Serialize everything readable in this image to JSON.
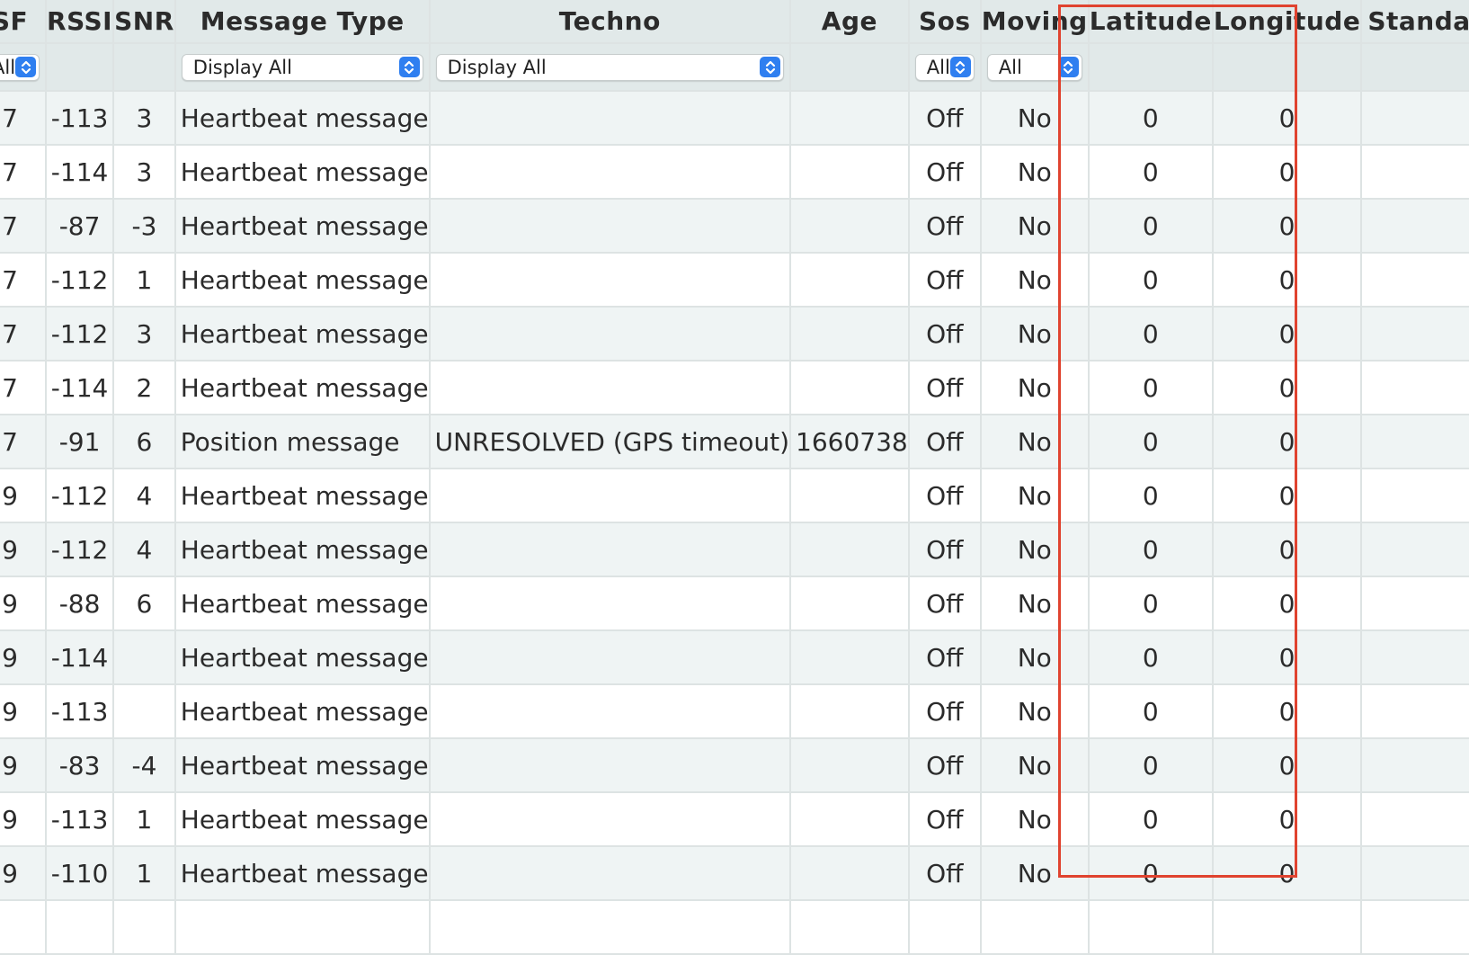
{
  "columns": {
    "sf": "SF",
    "rssi": "RSSI",
    "snr": "SNR",
    "message_type": "Message Type",
    "techno": "Techno",
    "age": "Age",
    "sos": "Sos",
    "moving": "Moving",
    "latitude": "Latitude",
    "longitude": "Longitude",
    "standard": "Standard"
  },
  "filters": {
    "sf": "All",
    "message_type": "Display All",
    "techno": "Display All",
    "sos": "All",
    "moving": "All"
  },
  "rows": [
    {
      "sf": "7",
      "rssi": "-113",
      "snr": "3",
      "message_type": "Heartbeat message",
      "techno": "",
      "age": "",
      "sos": "Off",
      "moving": "No",
      "latitude": "0",
      "longitude": "0"
    },
    {
      "sf": "7",
      "rssi": "-114",
      "snr": "3",
      "message_type": "Heartbeat message",
      "techno": "",
      "age": "",
      "sos": "Off",
      "moving": "No",
      "latitude": "0",
      "longitude": "0"
    },
    {
      "sf": "7",
      "rssi": "-87",
      "snr": "-3",
      "message_type": "Heartbeat message",
      "techno": "",
      "age": "",
      "sos": "Off",
      "moving": "No",
      "latitude": "0",
      "longitude": "0"
    },
    {
      "sf": "7",
      "rssi": "-112",
      "snr": "1",
      "message_type": "Heartbeat message",
      "techno": "",
      "age": "",
      "sos": "Off",
      "moving": "No",
      "latitude": "0",
      "longitude": "0"
    },
    {
      "sf": "7",
      "rssi": "-112",
      "snr": "3",
      "message_type": "Heartbeat message",
      "techno": "",
      "age": "",
      "sos": "Off",
      "moving": "No",
      "latitude": "0",
      "longitude": "0"
    },
    {
      "sf": "7",
      "rssi": "-114",
      "snr": "2",
      "message_type": "Heartbeat message",
      "techno": "",
      "age": "",
      "sos": "Off",
      "moving": "No",
      "latitude": "0",
      "longitude": "0"
    },
    {
      "sf": "7",
      "rssi": "-91",
      "snr": "6",
      "message_type": "Position message",
      "techno": "UNRESOLVED (GPS timeout)",
      "age": "1660738",
      "sos": "Off",
      "moving": "No",
      "latitude": "0",
      "longitude": "0"
    },
    {
      "sf": "9",
      "rssi": "-112",
      "snr": "4",
      "message_type": "Heartbeat message",
      "techno": "",
      "age": "",
      "sos": "Off",
      "moving": "No",
      "latitude": "0",
      "longitude": "0"
    },
    {
      "sf": "9",
      "rssi": "-112",
      "snr": "4",
      "message_type": "Heartbeat message",
      "techno": "",
      "age": "",
      "sos": "Off",
      "moving": "No",
      "latitude": "0",
      "longitude": "0"
    },
    {
      "sf": "9",
      "rssi": "-88",
      "snr": "6",
      "message_type": "Heartbeat message",
      "techno": "",
      "age": "",
      "sos": "Off",
      "moving": "No",
      "latitude": "0",
      "longitude": "0"
    },
    {
      "sf": "9",
      "rssi": "-114",
      "snr": "",
      "message_type": "Heartbeat message",
      "techno": "",
      "age": "",
      "sos": "Off",
      "moving": "No",
      "latitude": "0",
      "longitude": "0"
    },
    {
      "sf": "9",
      "rssi": "-113",
      "snr": "",
      "message_type": "Heartbeat message",
      "techno": "",
      "age": "",
      "sos": "Off",
      "moving": "No",
      "latitude": "0",
      "longitude": "0"
    },
    {
      "sf": "9",
      "rssi": "-83",
      "snr": "-4",
      "message_type": "Heartbeat message",
      "techno": "",
      "age": "",
      "sos": "Off",
      "moving": "No",
      "latitude": "0",
      "longitude": "0"
    },
    {
      "sf": "9",
      "rssi": "-113",
      "snr": "1",
      "message_type": "Heartbeat message",
      "techno": "",
      "age": "",
      "sos": "Off",
      "moving": "No",
      "latitude": "0",
      "longitude": "0"
    },
    {
      "sf": "9",
      "rssi": "-110",
      "snr": "1",
      "message_type": "Heartbeat message",
      "techno": "",
      "age": "",
      "sos": "Off",
      "moving": "No",
      "latitude": "0",
      "longitude": "0"
    },
    {
      "sf": "",
      "rssi": "",
      "snr": "",
      "message_type": "",
      "techno": "",
      "age": "",
      "sos": "",
      "moving": "",
      "latitude": "",
      "longitude": ""
    }
  ],
  "colors": {
    "header_bg": "#e1e9e9",
    "row_alt_bg": "#eff4f4",
    "select_arrow": "#2f7ff0",
    "highlight_border": "#e0432f"
  },
  "icons": {
    "select_arrow": "updown-chevron-icon"
  }
}
